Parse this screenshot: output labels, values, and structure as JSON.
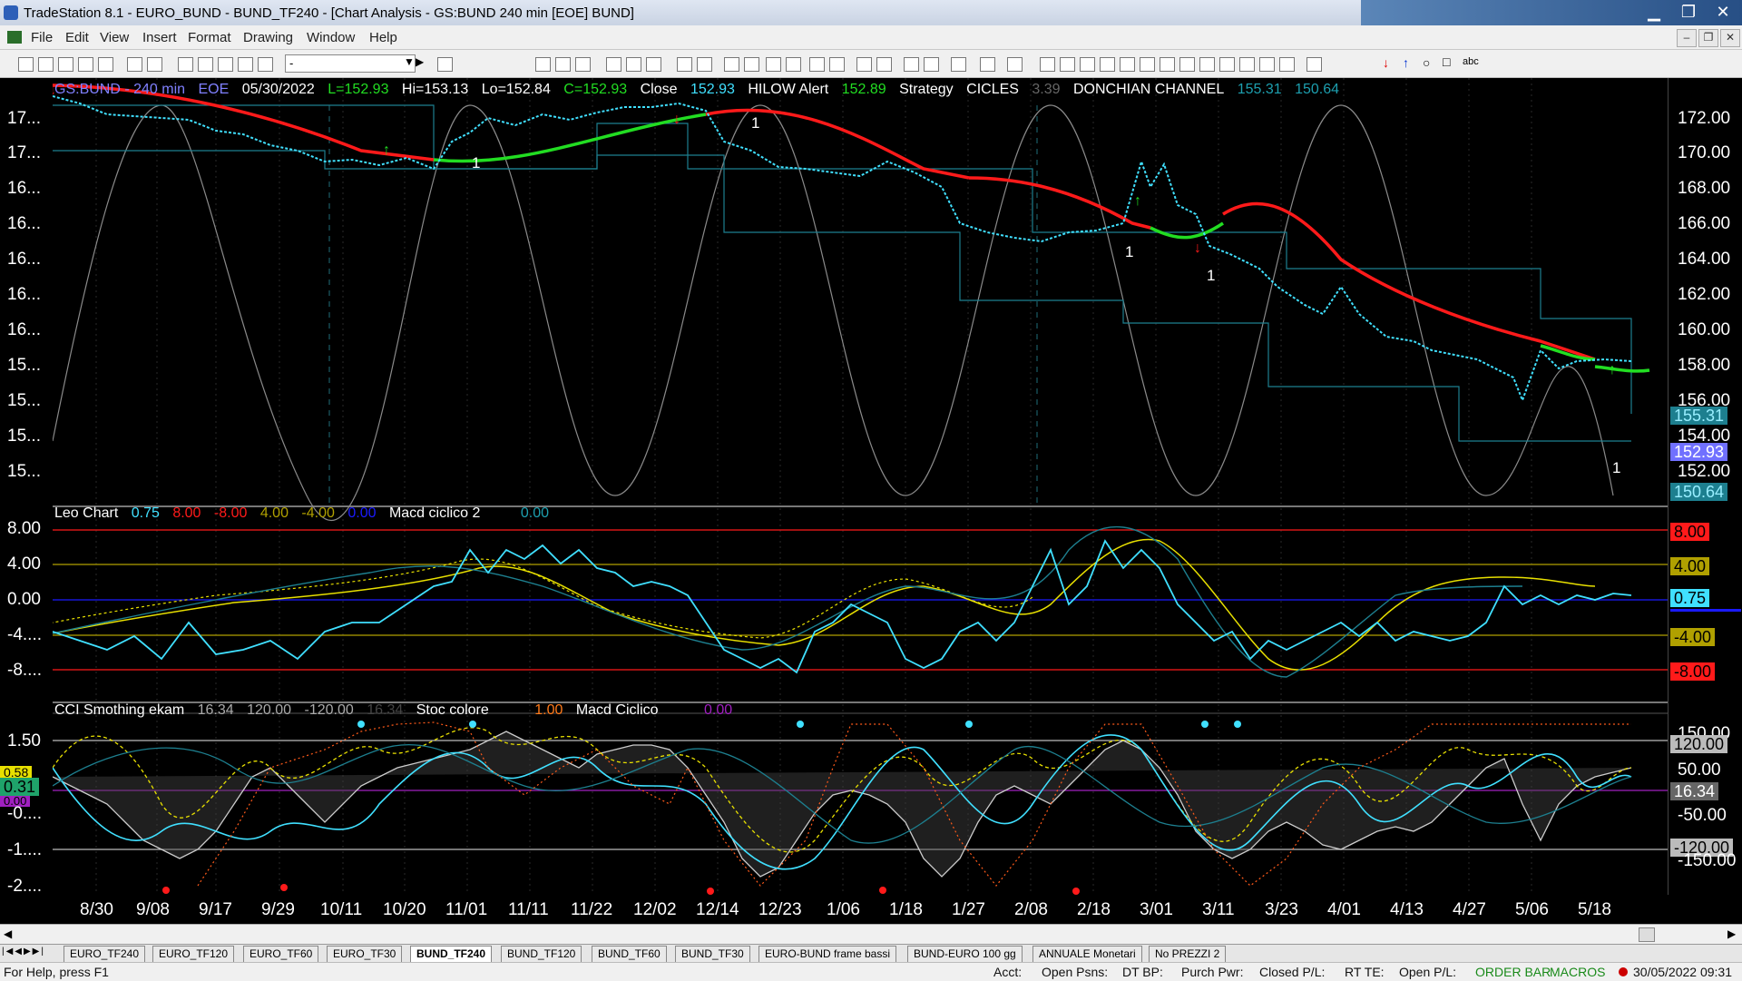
{
  "window": {
    "title": "TradeStation 8.1 - EURO_BUND - BUND_TF240 - [Chart Analysis - GS:BUND  240 min  [EOE] BUND]",
    "minimize": "▁",
    "restore": "❐",
    "close": "✕"
  },
  "menu": [
    "File",
    "Edit",
    "View",
    "Insert",
    "Format",
    "Drawing",
    "Window",
    "Help"
  ],
  "toolbar": {
    "select_value": "-"
  },
  "price_pane": {
    "header": {
      "symbol": "GS:BUND - 240 min",
      "session": "EOE",
      "date": "05/30/2022",
      "last": "L=152.93",
      "hi": "Hi=153.13",
      "lo": "Lo=152.84",
      "close_val": "C=152.93",
      "close_label": "Close",
      "close_num": "152.93",
      "hilow_label": "HILOW Alert",
      "hilow_num": "152.89",
      "strategy": "Strategy",
      "cicles": "CICLES",
      "cicles_num": "3.39",
      "donchian": "DONCHIAN CHANNEL",
      "don_hi": "155.31",
      "don_lo": "150.64"
    },
    "right_ticks": [
      "172.00",
      "170.00",
      "168.00",
      "166.00",
      "164.00",
      "162.00",
      "160.00",
      "158.00",
      "156.00",
      "154.00",
      "152.00"
    ],
    "left_ticks": [
      "17...",
      "17...",
      "16...",
      "16...",
      "16...",
      "16...",
      "16...",
      "15...",
      "15...",
      "15...",
      "15..."
    ],
    "tags": {
      "don_hi": "155.31",
      "price": "152.93",
      "don_lo": "150.64"
    },
    "markers": [
      "1",
      "1",
      "1",
      "1",
      "1",
      "1"
    ]
  },
  "leo_pane": {
    "header": {
      "name": "Leo Chart",
      "v1": "0.75",
      "v2": "8.00",
      "v3": "-8.00",
      "v4": "4.00",
      "v5": "-4.00",
      "v6": "0.00",
      "name2": "Macd ciclico 2",
      "v7": "0.00"
    },
    "right_ticks": [
      "8.00",
      "4.00",
      "0.00",
      "-4.00",
      "-8.00"
    ],
    "left_ticks": [
      "8.00",
      "4.00",
      "0.00",
      "-4....",
      "-8...."
    ],
    "tags": {
      "t8": "8.00",
      "t4": "4.00",
      "t0": "0.75",
      "tm4": "-4.00",
      "tm8": "-8.00"
    }
  },
  "cci_pane": {
    "header": {
      "name": "CCI Smothing ekam",
      "v1": "16.34",
      "v2": "120.00",
      "v3": "-120.00",
      "v4": "16.34",
      "name2": "Stoc colore",
      "v5": "1.00",
      "name3": "Macd Ciclico",
      "v6": "0.00"
    },
    "right_ticks": [
      "150.00",
      "50.00",
      "-50.00",
      "-150.00"
    ],
    "left_ticks": [
      "1.50",
      "-0....",
      "-1....",
      "-2...."
    ],
    "tags": {
      "t120": "120.00",
      "t16": "16.34",
      "tm120": "-120.00",
      "l_yellow": "0.58",
      "l_green": "0.31",
      "l_purple": "0.00"
    }
  },
  "dates": [
    "8/30",
    "9/08",
    "9/17",
    "9/29",
    "10/11",
    "10/20",
    "11/01",
    "11/11",
    "11/22",
    "12/02",
    "12/14",
    "12/23",
    "1/06",
    "1/18",
    "1/27",
    "2/08",
    "2/18",
    "3/01",
    "3/11",
    "3/23",
    "4/01",
    "4/13",
    "4/27",
    "5/06",
    "5/18"
  ],
  "tabs": [
    "EURO_TF240",
    "EURO_TF120",
    "EURO_TF60",
    "EURO_TF30",
    "BUND_TF240",
    "BUND_TF120",
    "BUND_TF60",
    "BUND_TF30",
    "EURO-BUND frame bassi",
    "BUND-EURO 100 gg",
    "ANNUALE Monetari",
    "No PREZZI 2"
  ],
  "status": {
    "help": "For Help, press F1",
    "acct": "Acct:",
    "open_psns": "Open Psns:",
    "dt_bp": "DT BP:",
    "purch_pwr": "Purch Pwr:",
    "closed_pl": "Closed P/L:",
    "rt_te": "RT TE:",
    "open_pl": "Open P/L:",
    "order_bar": "ORDER BAR",
    "macros": "MACROS",
    "datetime": "30/05/2022 09:31"
  },
  "colors": {
    "accent_cyan": "#40e0ff",
    "red": "#ff1a1a",
    "green": "#22dd22",
    "yellow": "#e8e000"
  }
}
